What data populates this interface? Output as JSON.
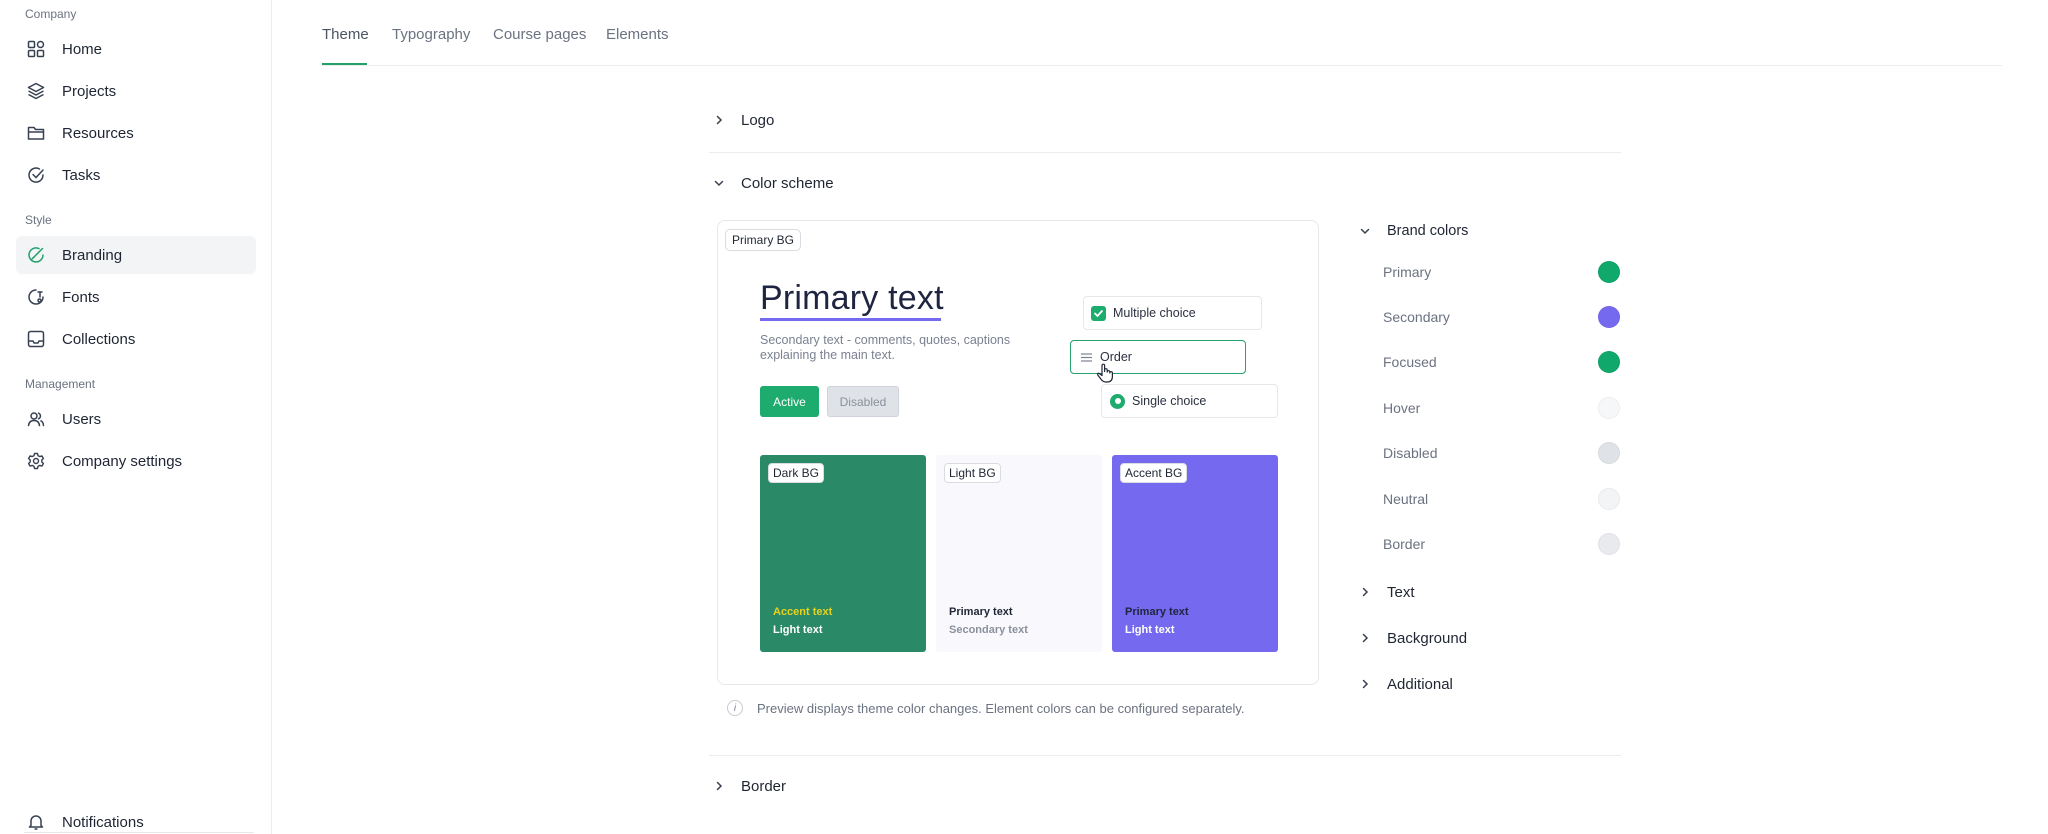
{
  "sidebar": {
    "groups": [
      "Company",
      "Style",
      "Management"
    ],
    "items": [
      {
        "label": "Home",
        "icon": "home-grid-icon"
      },
      {
        "label": "Projects",
        "icon": "layers-icon"
      },
      {
        "label": "Resources",
        "icon": "folder-icon"
      },
      {
        "label": "Tasks",
        "icon": "check-circle-icon"
      },
      {
        "label": "Branding",
        "icon": "palette-icon",
        "active": true
      },
      {
        "label": "Fonts",
        "icon": "font-icon"
      },
      {
        "label": "Collections",
        "icon": "inbox-icon"
      },
      {
        "label": "Users",
        "icon": "users-icon"
      },
      {
        "label": "Company settings",
        "icon": "gear-icon"
      },
      {
        "label": "Notifications",
        "icon": "bell-icon"
      }
    ]
  },
  "tabs": [
    {
      "label": "Theme",
      "active": true
    },
    {
      "label": "Typography"
    },
    {
      "label": "Course pages"
    },
    {
      "label": "Elements"
    }
  ],
  "sections": {
    "logo": "Logo",
    "color_scheme": "Color scheme",
    "border": "Border"
  },
  "preview": {
    "primary_bg_tag": "Primary BG",
    "primary_text": "Primary text",
    "secondary_text": "Secondary text - comments, quotes, captions explaining the main text.",
    "active_button": "Active",
    "disabled_button": "Disabled",
    "multiple_choice": "Multiple choice",
    "order": "Order",
    "single_choice": "Single choice",
    "panels": {
      "dark": {
        "tag": "Dark BG",
        "line1": "Accent text",
        "line2": "Light text",
        "bg": "#2a8a67"
      },
      "light": {
        "tag": "Light BG",
        "line1": "Primary text",
        "line2": "Secondary text",
        "bg": "#f9f9fd"
      },
      "accent": {
        "tag": "Accent BG",
        "line1": "Primary text",
        "line2": "Light text",
        "bg": "#7569ef"
      }
    },
    "info_text": "Preview displays theme color changes. Element colors can be configured separately."
  },
  "brand_colors": {
    "title": "Brand colors",
    "items": [
      {
        "label": "Primary",
        "color": "#10a86b"
      },
      {
        "label": "Secondary",
        "color": "#7569ef"
      },
      {
        "label": "Focused",
        "color": "#10a86b"
      },
      {
        "label": "Hover",
        "color": "#f6f7f8"
      },
      {
        "label": "Disabled",
        "color": "#dfe2e6"
      },
      {
        "label": "Neutral",
        "color": "#f3f4f6"
      },
      {
        "label": "Border",
        "color": "#e8eaee"
      }
    ]
  },
  "more_sections": [
    "Text",
    "Background",
    "Additional"
  ],
  "colors": {
    "accent_green": "#22a06b",
    "accent_purple": "#7569ef"
  }
}
